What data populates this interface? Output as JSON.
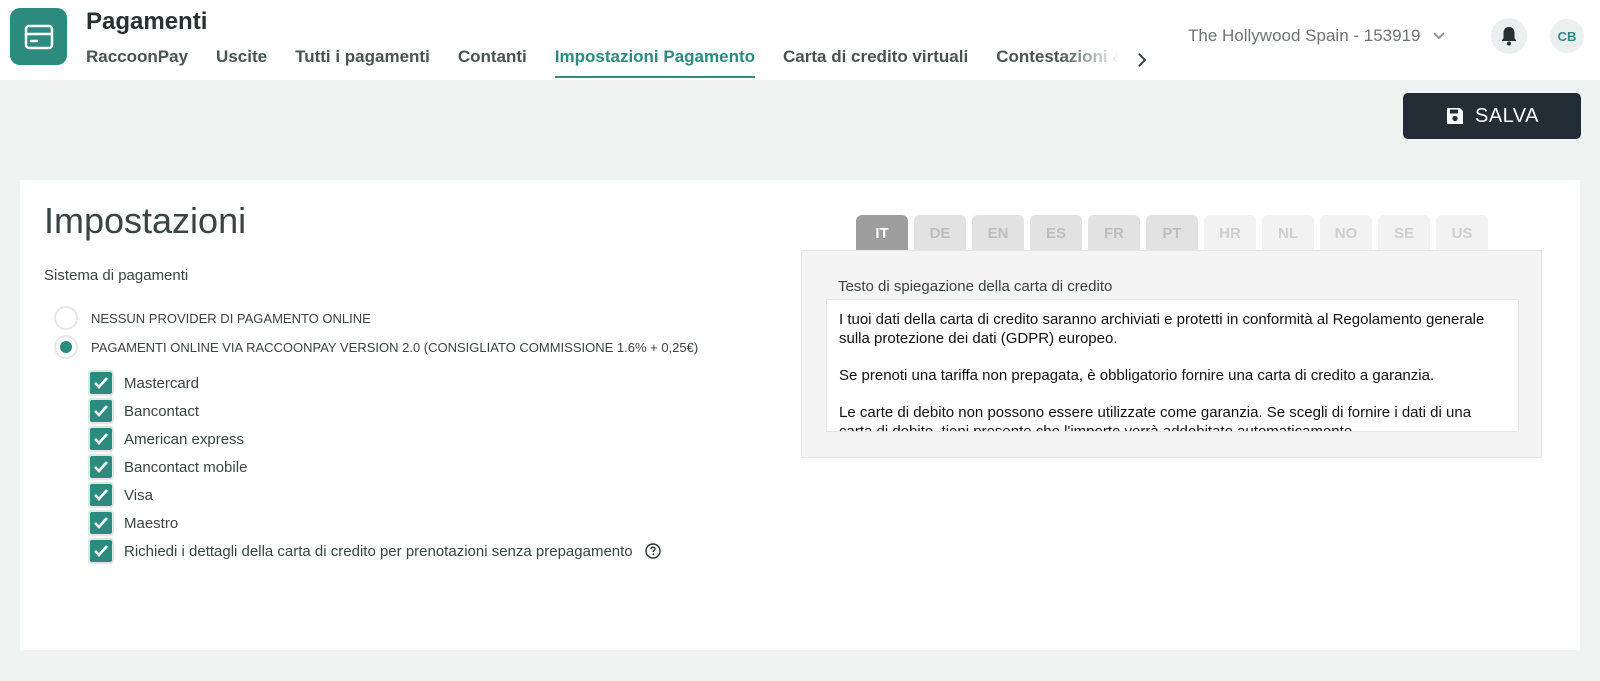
{
  "header": {
    "app_title": "Pagamenti",
    "app_icon": "payment-card-icon",
    "tabs": [
      {
        "label": "RaccoonPay"
      },
      {
        "label": "Uscite"
      },
      {
        "label": "Tutti i pagamenti"
      },
      {
        "label": "Contanti"
      },
      {
        "label": "Impostazioni Pagamento",
        "active": true
      },
      {
        "label": "Carta di credito virtuali"
      },
      {
        "label": "Contestazioni &"
      }
    ],
    "property_name": "The Hollywood Spain - 153919",
    "avatar_initials": "CB",
    "accent_color": "#2d8a7e"
  },
  "toolbar": {
    "save_label": "SALVA",
    "save_icon": "floppy-disk-icon"
  },
  "settings": {
    "title": "Impostazioni",
    "section_label": "Sistema di pagamenti",
    "providers": [
      {
        "label": "NESSUN PROVIDER DI PAGAMENTO ONLINE",
        "selected": false
      },
      {
        "label": "PAGAMENTI ONLINE VIA RACCOONPAY VERSION 2.0 (CONSIGLIATO COMMISSIONE 1.6% + 0,25€)",
        "selected": true
      }
    ],
    "methods": [
      {
        "label": "Mastercard",
        "checked": true
      },
      {
        "label": "Bancontact",
        "checked": true
      },
      {
        "label": "American express",
        "checked": true
      },
      {
        "label": "Bancontact mobile",
        "checked": true
      },
      {
        "label": "Visa",
        "checked": true
      },
      {
        "label": "Maestro",
        "checked": true
      },
      {
        "label": "Richiedi i dettagli della carta di credito per prenotazioni senza prepagamento",
        "checked": true
      }
    ]
  },
  "languages": {
    "tabs": [
      "IT",
      "DE",
      "EN",
      "ES",
      "FR",
      "PT",
      "HR",
      "NL",
      "NO",
      "SE",
      "US"
    ],
    "active": "IT"
  },
  "explanation": {
    "label": "Testo di spiegazione della carta di credito",
    "paragraphs": [
      "I tuoi dati della carta di credito saranno archiviati e protetti in conformità al Regolamento generale sulla protezione dei dati (GDPR) europeo.",
      "Se prenoti una tariffa non prepagata, è obbligatorio fornire una carta di credito a garanzia.",
      "Le carte di debito non possono essere utilizzate come garanzia. Se scegli di fornire i dati di una carta di debito, tieni presente che l'importo verrà addebitato automaticamente"
    ]
  }
}
